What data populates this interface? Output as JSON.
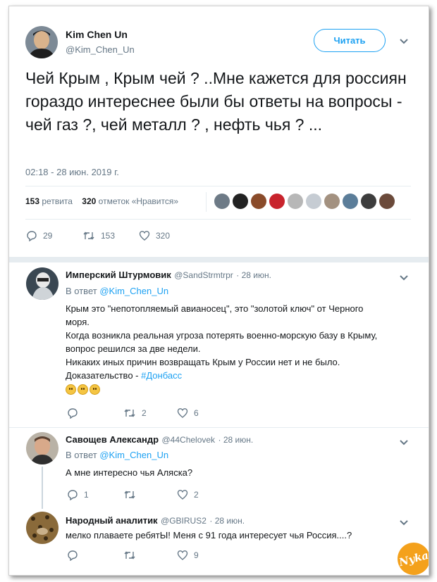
{
  "main_tweet": {
    "author_name": "Kim Chen Un",
    "author_handle": "@Kim_Chen_Un",
    "follow_label": "Читать",
    "text": "Чей Крым , Крым чей ? ..Мне кажется для россиян гораздо интереснее были бы ответы на вопросы - чей газ ?, чей металл ? , нефть чья ? ...",
    "date": "02:18 - 28 июн. 2019 г.",
    "retweets_count": "153",
    "retweets_label": "ретвита",
    "likes_count": "320",
    "likes_label": "отметок «Нравится»",
    "actions": {
      "replies": "29",
      "retweets": "153",
      "likes": "320"
    }
  },
  "replies": [
    {
      "name": "Имперский Штурмовик",
      "handle": "@SandStrmtrpr",
      "time": "· 28 июн.",
      "reply_to_prefix": "В ответ",
      "reply_to": "@Kim_Chen_Un",
      "lines": [
        "Крым это \"непотопляемый авианосец\", это \"золотой ключ\" от Черного",
        "моря.",
        "Когда возникла реальная угроза потерять военно-морскую базу в Крыму,",
        "вопрос решился за две недели.",
        "Никаких иных причин возвращать Крым у России нет и не было.",
        "Доказательство -"
      ],
      "hashtag": "#Донбасс",
      "actions": {
        "replies": "",
        "retweets": "2",
        "likes": "6"
      }
    },
    {
      "name": "Савощев Александр",
      "handle": "@44Chelovek",
      "time": "· 28 июн.",
      "reply_to_prefix": "В ответ",
      "reply_to": "@Kim_Chen_Un",
      "text": "А мне интересно чья Аляска?",
      "actions": {
        "replies": "1",
        "retweets": "",
        "likes": "2"
      }
    },
    {
      "name": "Народный аналитик",
      "handle": "@GBIRUS2",
      "time": "· 28 июн.",
      "text": "мелко плаваете ребятЫ! Меня с 91 года интересует чья Россия....?",
      "actions": {
        "replies": "",
        "retweets": "",
        "likes": "9"
      }
    }
  ],
  "watermark": "Nyka",
  "colors": {
    "accent": "#1da1f2",
    "muted": "#657786",
    "text": "#14171a",
    "divider": "#e6ecf0"
  }
}
